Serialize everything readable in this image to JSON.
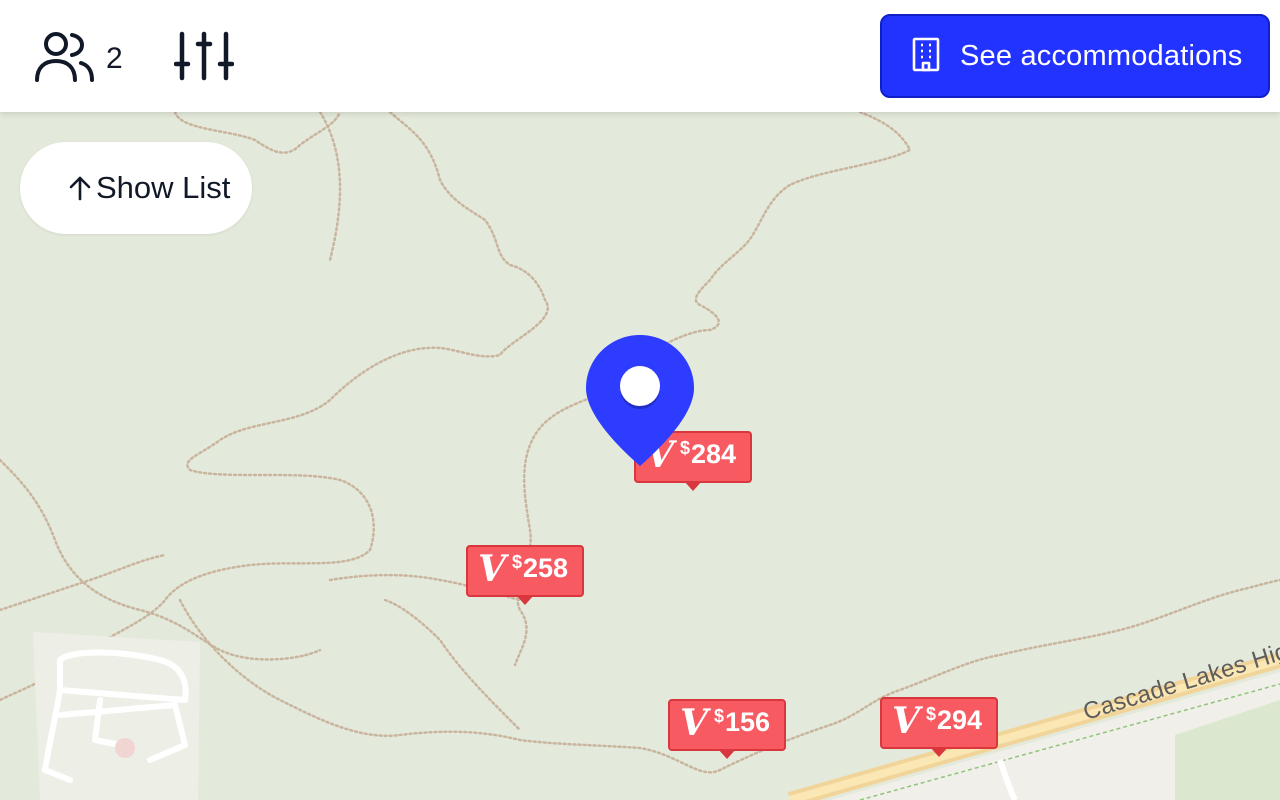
{
  "header": {
    "guests_count": "2",
    "cta_label": "See accommodations"
  },
  "map": {
    "show_list_label": "Show List",
    "road_label": "Cascade Lakes Highway",
    "markers": [
      {
        "currency": "$",
        "price": "284"
      },
      {
        "currency": "$",
        "price": "258"
      },
      {
        "currency": "$",
        "price": "156"
      },
      {
        "currency": "$",
        "price": "294"
      }
    ]
  },
  "colors": {
    "accent_blue": "#2333ff",
    "price_marker": "#f85a62",
    "map_background": "#e4eadb"
  },
  "icons": [
    "users-icon",
    "sliders-icon",
    "building-icon",
    "arrow-up-icon",
    "location-pin-icon",
    "vrbo-logo-icon"
  ]
}
